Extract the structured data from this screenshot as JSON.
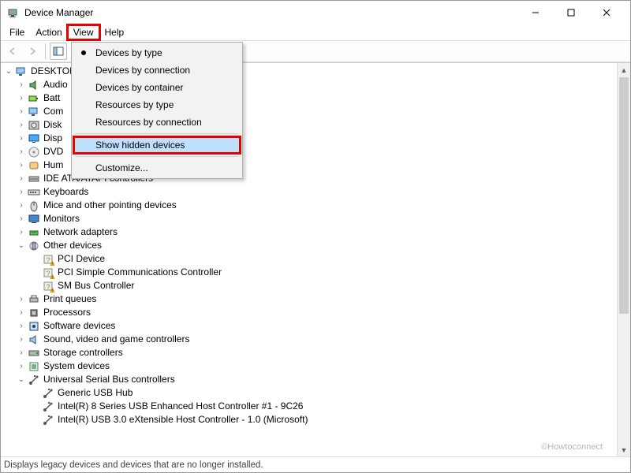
{
  "window": {
    "title": "Device Manager"
  },
  "menubar": {
    "items": [
      "File",
      "Action",
      "View",
      "Help"
    ],
    "highlighted": "View"
  },
  "dropdown": {
    "items": [
      {
        "label": "Devices by type",
        "checked": true
      },
      {
        "label": "Devices by connection"
      },
      {
        "label": "Devices by container"
      },
      {
        "label": "Resources by type"
      },
      {
        "label": "Resources by connection"
      },
      {
        "sep": true
      },
      {
        "label": "Show hidden devices",
        "selected": true,
        "redbox": true
      },
      {
        "sep": true
      },
      {
        "label": "Customize..."
      }
    ]
  },
  "tree": {
    "root_label": "DESKTOP",
    "nodes": [
      {
        "label": "Audio",
        "icon": "audio",
        "twisty": "closed",
        "truncated": true
      },
      {
        "label": "Batt",
        "icon": "battery",
        "twisty": "closed",
        "truncated": true
      },
      {
        "label": "Com",
        "icon": "computer",
        "twisty": "closed",
        "truncated": true
      },
      {
        "label": "Disk",
        "icon": "disk",
        "twisty": "closed",
        "truncated": true
      },
      {
        "label": "Disp",
        "icon": "display",
        "twisty": "closed",
        "truncated": true
      },
      {
        "label": "DVD",
        "icon": "dvd",
        "twisty": "closed",
        "truncated": true
      },
      {
        "label": "Hum",
        "icon": "hid",
        "twisty": "closed",
        "truncated": true
      },
      {
        "label": "IDE ATA/ATAPI controllers",
        "icon": "ide",
        "twisty": "closed"
      },
      {
        "label": "Keyboards",
        "icon": "keyboard",
        "twisty": "closed"
      },
      {
        "label": "Mice and other pointing devices",
        "icon": "mouse",
        "twisty": "closed"
      },
      {
        "label": "Monitors",
        "icon": "monitor",
        "twisty": "closed"
      },
      {
        "label": "Network adapters",
        "icon": "network",
        "twisty": "closed"
      },
      {
        "label": "Other devices",
        "icon": "other",
        "twisty": "open",
        "children": [
          {
            "label": "PCI Device",
            "icon": "unknown"
          },
          {
            "label": "PCI Simple Communications Controller",
            "icon": "unknown"
          },
          {
            "label": "SM Bus Controller",
            "icon": "unknown"
          }
        ]
      },
      {
        "label": "Print queues",
        "icon": "printer",
        "twisty": "closed"
      },
      {
        "label": "Processors",
        "icon": "cpu",
        "twisty": "closed"
      },
      {
        "label": "Software devices",
        "icon": "software",
        "twisty": "closed"
      },
      {
        "label": "Sound, video and game controllers",
        "icon": "sound",
        "twisty": "closed"
      },
      {
        "label": "Storage controllers",
        "icon": "storage",
        "twisty": "closed"
      },
      {
        "label": "System devices",
        "icon": "system",
        "twisty": "closed"
      },
      {
        "label": "Universal Serial Bus controllers",
        "icon": "usb",
        "twisty": "open",
        "children": [
          {
            "label": "Generic USB Hub",
            "icon": "usb"
          },
          {
            "label": "Intel(R) 8 Series USB Enhanced Host Controller #1 - 9C26",
            "icon": "usb"
          },
          {
            "label": "Intel(R) USB 3.0 eXtensible Host Controller - 1.0 (Microsoft)",
            "icon": "usb"
          }
        ]
      }
    ]
  },
  "statusbar": {
    "text": "Displays legacy devices and devices that are no longer installed."
  },
  "watermark": "©Howtoconnect"
}
